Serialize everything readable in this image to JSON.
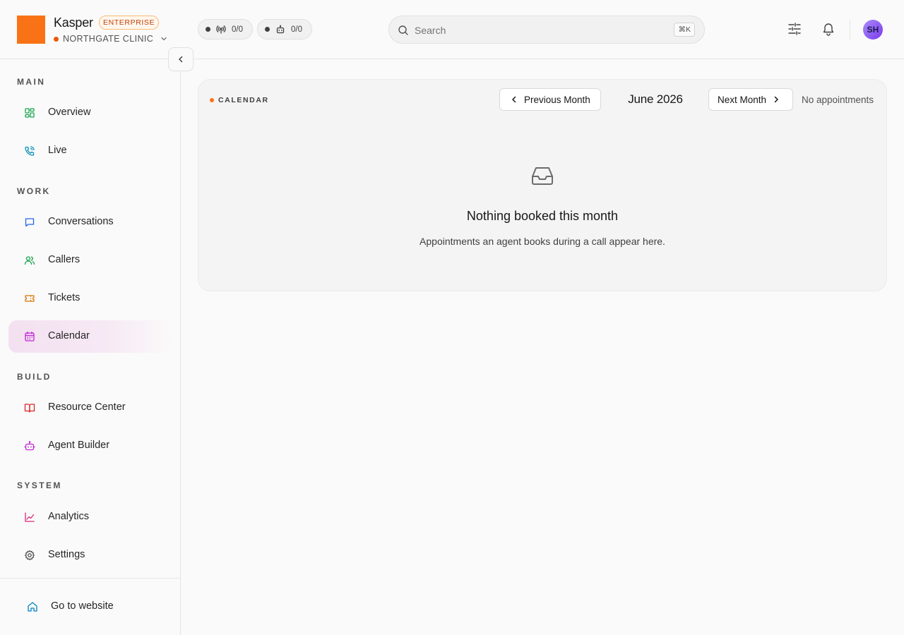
{
  "brand": {
    "name": "Kasper",
    "plan": "ENTERPRISE",
    "org": "NORTHGATE CLINIC",
    "logo_color": "#f97316"
  },
  "topbar": {
    "live_calls": "0/0",
    "agents": "0/0",
    "search_placeholder": "Search",
    "search_shortcut": "⌘K",
    "avatar_initials": "SH"
  },
  "sidebar": {
    "sections": {
      "main": "MAIN",
      "work": "WORK",
      "build": "BUILD",
      "system": "SYSTEM"
    },
    "items": {
      "overview": "Overview",
      "live": "Live",
      "conversations": "Conversations",
      "callers": "Callers",
      "tickets": "Tickets",
      "calendar": "Calendar",
      "resource_center": "Resource Center",
      "agent_builder": "Agent Builder",
      "analytics": "Analytics",
      "settings": "Settings"
    },
    "active_item": "Calendar",
    "footer": "Go to website"
  },
  "calendar": {
    "tag": "CALENDAR",
    "prev_label": "Previous Month",
    "next_label": "Next Month",
    "month": "June 2026",
    "status": "No appointments",
    "empty_title": "Nothing booked this month",
    "empty_subtitle": "Appointments an agent books during a call appear here."
  },
  "colors": {
    "accent": "#f97316",
    "active_bg": "#f3e0f0",
    "avatar": "#8b5cf6"
  }
}
